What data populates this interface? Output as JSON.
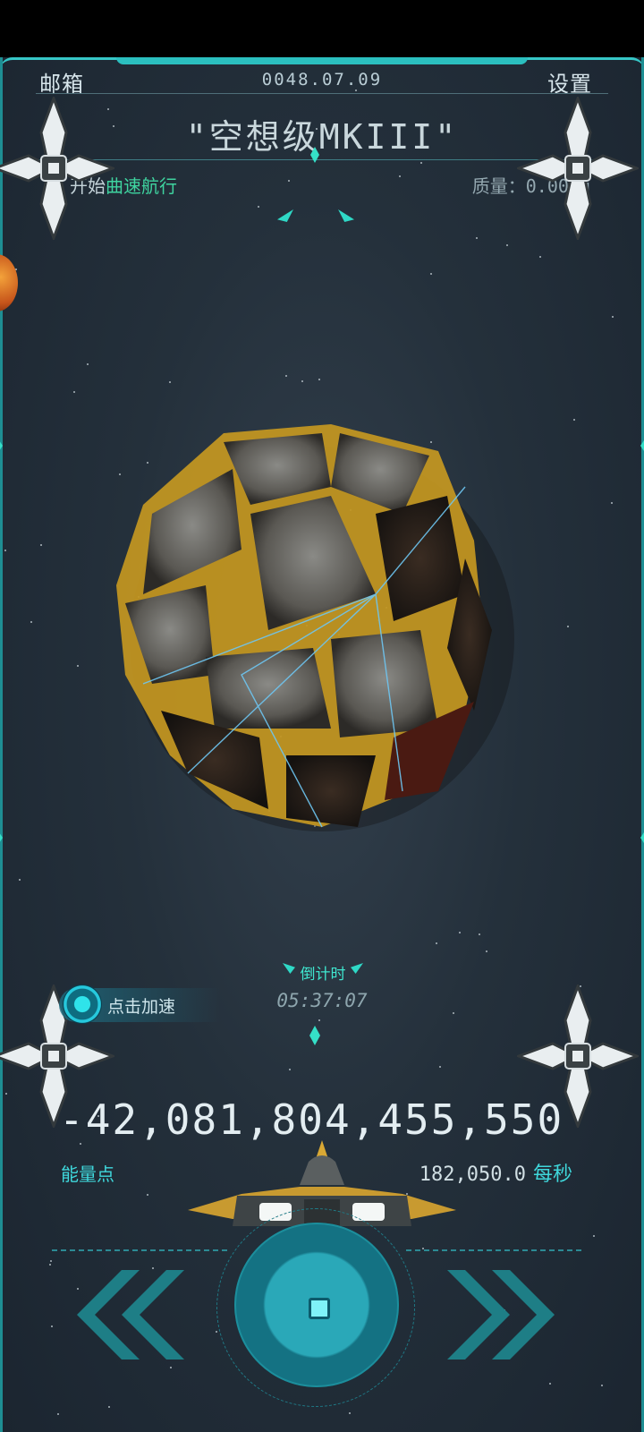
{
  "header": {
    "mailbox_label": "邮箱",
    "date": "0048.07.09",
    "settings_label": "设置",
    "ship_name": "\"空想级MKIII\""
  },
  "status": {
    "warp_prefix": "开始",
    "warp_highlight": "曲速航行",
    "mass": "质量：0.00kg"
  },
  "boost": {
    "label": "点击加速"
  },
  "countdown": {
    "label": "倒计时",
    "time": "05:37:07"
  },
  "energy": {
    "value": "-42,081,804,455,550",
    "label": "能量点",
    "rate_value": "182,050.0",
    "rate_unit": "每秒"
  },
  "colors": {
    "accent": "#2fd8c6",
    "energy_label": "#3fd8dc",
    "warp_green": "#3fd4a0",
    "gold": "#e8b830"
  },
  "icons": {
    "left_button": "double-chevron-left-icon",
    "right_button": "double-chevron-right-icon",
    "center_button": "warp-core-icon",
    "turret": "turret-satellite-icon"
  }
}
